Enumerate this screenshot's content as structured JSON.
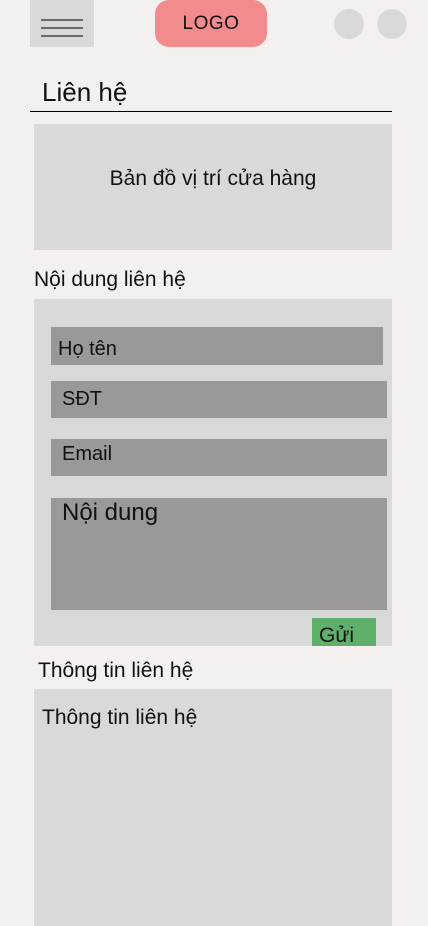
{
  "header": {
    "logo_text": "LOGO",
    "menu_icon": "hamburger-icon",
    "right_icons": [
      "circle-icon",
      "circle-icon"
    ]
  },
  "page": {
    "title": "Liên hệ"
  },
  "map": {
    "label": "Bản đồ vị trí cửa hàng"
  },
  "contact_form": {
    "section_label": "Nội dung liên hệ",
    "name_field": "Họ tên",
    "phone_field": "SĐT",
    "email_field": "Email",
    "message_field": "Nội dung",
    "submit_label": "Gửi"
  },
  "contact_info": {
    "section_label": "Thông tin liên hệ",
    "content": "Thông tin liên hệ"
  },
  "colors": {
    "background": "#f5f0f0",
    "panel": "#d9d9d9",
    "field": "#9a9898",
    "logo": "#f28b8b",
    "submit": "#5fb06a"
  }
}
